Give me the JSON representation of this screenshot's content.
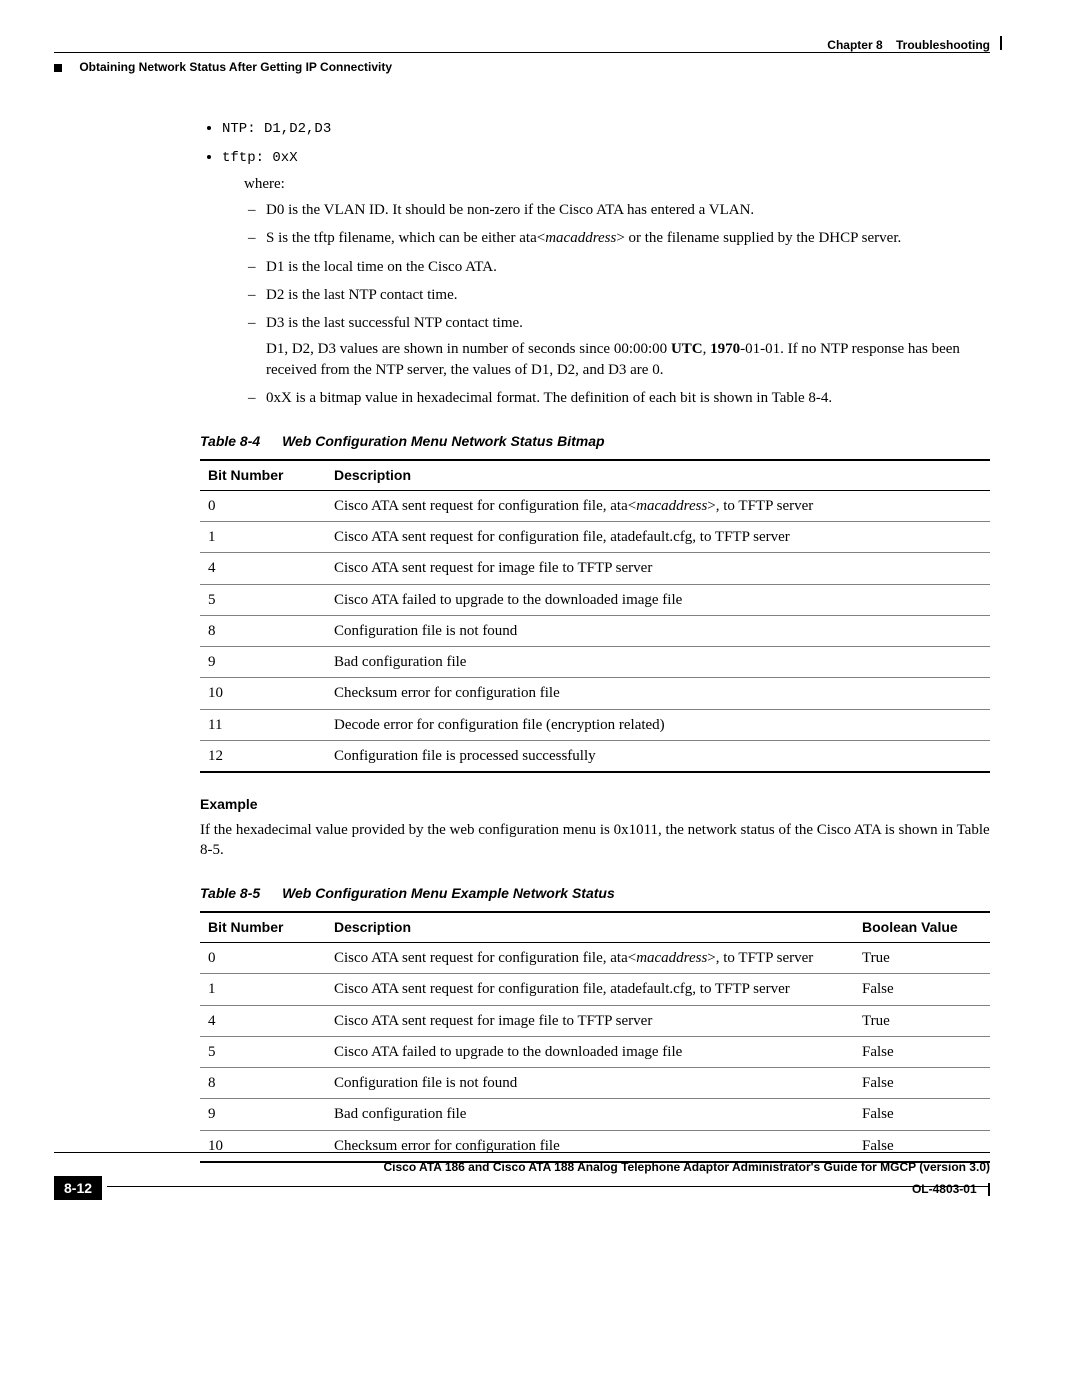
{
  "header": {
    "chapter_label": "Chapter 8",
    "chapter_title": "Troubleshooting",
    "section_title": "Obtaining Network Status After Getting IP Connectivity"
  },
  "bullets": {
    "ntp": "NTP: D1,D2,D3",
    "tftp": "tftp: 0xX",
    "where": "where:",
    "sub": [
      "D0 is the VLAN ID. It should be non-zero if the Cisco ATA has entered a VLAN.",
      "S is the tftp filename, which can be either ata<macaddress> or the filename supplied by the DHCP server.",
      "D1 is the local time on the Cisco ATA.",
      "D2 is the last NTP contact time.",
      "D3 is the last successful NTP contact time."
    ],
    "d_note": "D1, D2, D3 values are shown in number of seconds since 00:00:00 UTC, 1970-01-01. If no NTP response has been received from the NTP server, the values of D1, D2, and D3 are 0.",
    "bitmap_note": "0xX is a bitmap value in hexadecimal format. The definition of each bit is shown in Table 8-4."
  },
  "table84": {
    "number": "Table 8-4",
    "title": "Web Configuration Menu Network Status Bitmap",
    "headers": {
      "bit": "Bit Number",
      "desc": "Description"
    },
    "rows": [
      {
        "bit": "0",
        "desc": "Cisco ATA sent request for configuration file, ata<macaddress>, to TFTP server"
      },
      {
        "bit": "1",
        "desc": "Cisco ATA sent request for configuration file, atadefault.cfg, to TFTP server"
      },
      {
        "bit": "4",
        "desc": "Cisco ATA sent request for image file to TFTP server"
      },
      {
        "bit": "5",
        "desc": "Cisco ATA failed to upgrade to the downloaded image file"
      },
      {
        "bit": "8",
        "desc": "Configuration file is not found"
      },
      {
        "bit": "9",
        "desc": "Bad configuration file"
      },
      {
        "bit": "10",
        "desc": "Checksum error for configuration file"
      },
      {
        "bit": "11",
        "desc": "Decode error for configuration file (encryption related)"
      },
      {
        "bit": "12",
        "desc": "Configuration file is processed successfully"
      }
    ]
  },
  "example": {
    "heading": "Example",
    "body": "If the hexadecimal value provided by the web configuration menu is 0x1011, the network status of the Cisco ATA is shown in Table 8-5."
  },
  "table85": {
    "number": "Table 8-5",
    "title": "Web Configuration Menu Example Network Status",
    "headers": {
      "bit": "Bit Number",
      "desc": "Description",
      "bool": "Boolean Value"
    },
    "rows": [
      {
        "bit": "0",
        "desc": "Cisco ATA sent request for configuration file, ata<macaddress>, to TFTP server",
        "bool": "True"
      },
      {
        "bit": "1",
        "desc": "Cisco ATA sent request for configuration file, atadefault.cfg, to TFTP server",
        "bool": "False"
      },
      {
        "bit": "4",
        "desc": "Cisco ATA sent request for image file to TFTP server",
        "bool": "True"
      },
      {
        "bit": "5",
        "desc": "Cisco ATA failed to upgrade to the downloaded image file",
        "bool": "False"
      },
      {
        "bit": "8",
        "desc": "Configuration file is not found",
        "bool": "False"
      },
      {
        "bit": "9",
        "desc": "Bad configuration file",
        "bool": "False"
      },
      {
        "bit": "10",
        "desc": "Checksum error for configuration file",
        "bool": "False"
      }
    ]
  },
  "footer": {
    "book_title": "Cisco ATA 186 and Cisco ATA 188 Analog Telephone Adaptor Administrator's Guide for MGCP (version 3.0)",
    "page": "8-12",
    "doc_id": "OL-4803-01"
  }
}
